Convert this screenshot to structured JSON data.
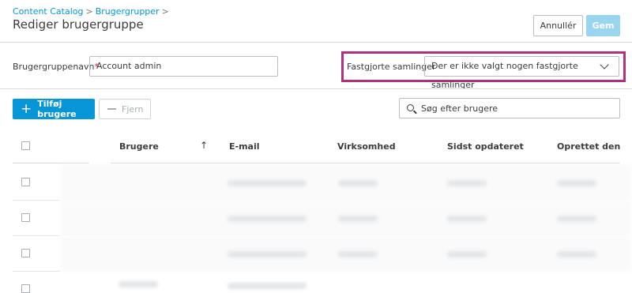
{
  "breadcrumb": {
    "items": [
      "Content Catalog",
      "Brugergrupper"
    ],
    "separator": ">"
  },
  "page": {
    "title": "Rediger brugergruppe"
  },
  "actions": {
    "cancel_label": "Annullér",
    "save_label": "Gem"
  },
  "form": {
    "name_label": "Brugergruppenavn",
    "required_mark": "*",
    "name_value": "Account admin",
    "pinned_label": "Fastgjorte samlinger",
    "pinned_value": "Der er ikke valgt nogen fastgjorte samlinger"
  },
  "toolbar": {
    "add_label": "Tilføj brugere",
    "add_icon": "+",
    "remove_label": "Fjern",
    "search_placeholder": "Søg efter brugere"
  },
  "table": {
    "columns": [
      "Brugere",
      "E-mail",
      "Virksomhed",
      "Sidst opdateret",
      "Oprettet den"
    ],
    "sort_indicator": "↑"
  },
  "colors": {
    "accent": "#0696d7",
    "highlight": "#b0307b",
    "save_disabled": "#99d5ef",
    "required": "#e0233b"
  }
}
